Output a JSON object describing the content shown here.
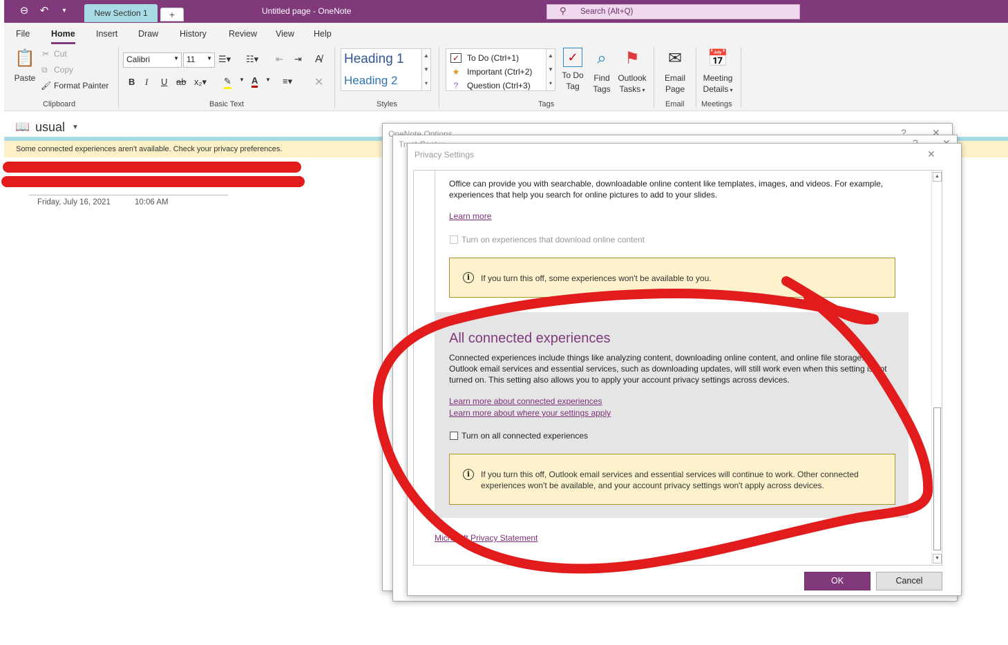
{
  "titlebar": {
    "title": "Untitled page  -  OneNote",
    "search_placeholder": "Search (Alt+Q)",
    "color": "#80397b"
  },
  "tabs": [
    {
      "label": "File"
    },
    {
      "label": "Home"
    },
    {
      "label": "Insert"
    },
    {
      "label": "Draw"
    },
    {
      "label": "History"
    },
    {
      "label": "Review"
    },
    {
      "label": "View"
    },
    {
      "label": "Help"
    }
  ],
  "ribbon": {
    "clipboard": {
      "paste": "Paste",
      "cut": "Cut",
      "copy": "Copy",
      "format_painter": "Format Painter",
      "label": "Clipboard"
    },
    "basic_text": {
      "font": "Calibri",
      "size": "11",
      "bold": "B",
      "italic": "I",
      "underline": "U",
      "strike": "ab",
      "label": "Basic Text"
    },
    "styles": {
      "heading1": "Heading 1",
      "heading2": "Heading 2",
      "label": "Styles"
    },
    "tags": {
      "items": [
        {
          "label": "To Do (Ctrl+1)",
          "icon": "checkbox-icon"
        },
        {
          "label": "Important (Ctrl+2)",
          "icon": "star-icon"
        },
        {
          "label": "Question (Ctrl+3)",
          "icon": "question-icon"
        }
      ],
      "todo_tag_1": "To Do",
      "todo_tag_2": "Tag",
      "find_tags_1": "Find",
      "find_tags_2": "Tags",
      "outlook_tasks_1": "Outlook",
      "outlook_tasks_2": "Tasks",
      "label": "Tags"
    },
    "email": {
      "btn_1": "Email",
      "btn_2": "Page",
      "label": "Email"
    },
    "meetings": {
      "btn_1": "Meeting",
      "btn_2": "Details",
      "label": "Meetings"
    }
  },
  "notebook": {
    "name": "usual",
    "section": "New Section 1",
    "add": "+"
  },
  "infobar": {
    "text": "Some connected experiences aren't available. Check your privacy preferences."
  },
  "page": {
    "date": "Friday, July 16, 2021",
    "time": "10:06 AM"
  },
  "dialogs": {
    "options_title": "OneNote Options",
    "trust_title": "Trust Center",
    "privacy_title": "Privacy Settings"
  },
  "privacy": {
    "download_text_1": "Office can provide you with searchable, downloadable online content like templates, images, and videos. For example,",
    "download_text_2": "experiences that help you search for online pictures to add to your slides.",
    "learn_more": "Learn more",
    "download_checkbox": "Turn on experiences that download online content",
    "download_warning": "If you turn this off, some experiences won't be available to you.",
    "all_heading": "All connected experiences",
    "all_text_1": "Connected experiences include things like analyzing content, downloading online content, and online file storage.",
    "all_text_2": "Outlook email services and essential services, such as downloading updates, will still work even when this setting is not",
    "all_text_3": "turned on. This setting also allows you to apply your account privacy settings across devices.",
    "link_connected": "Learn more about connected experiences",
    "link_where": "Learn more about where your settings apply",
    "all_checkbox": "Turn on all connected experiences",
    "all_warning_1": "If you turn this off, Outlook email services and essential services will continue to work. Other connected",
    "all_warning_2": "experiences won't be available, and your account privacy settings won't apply across devices.",
    "privacy_statement": "Microsoft Privacy Statement",
    "ok": "OK",
    "cancel": "Cancel"
  }
}
